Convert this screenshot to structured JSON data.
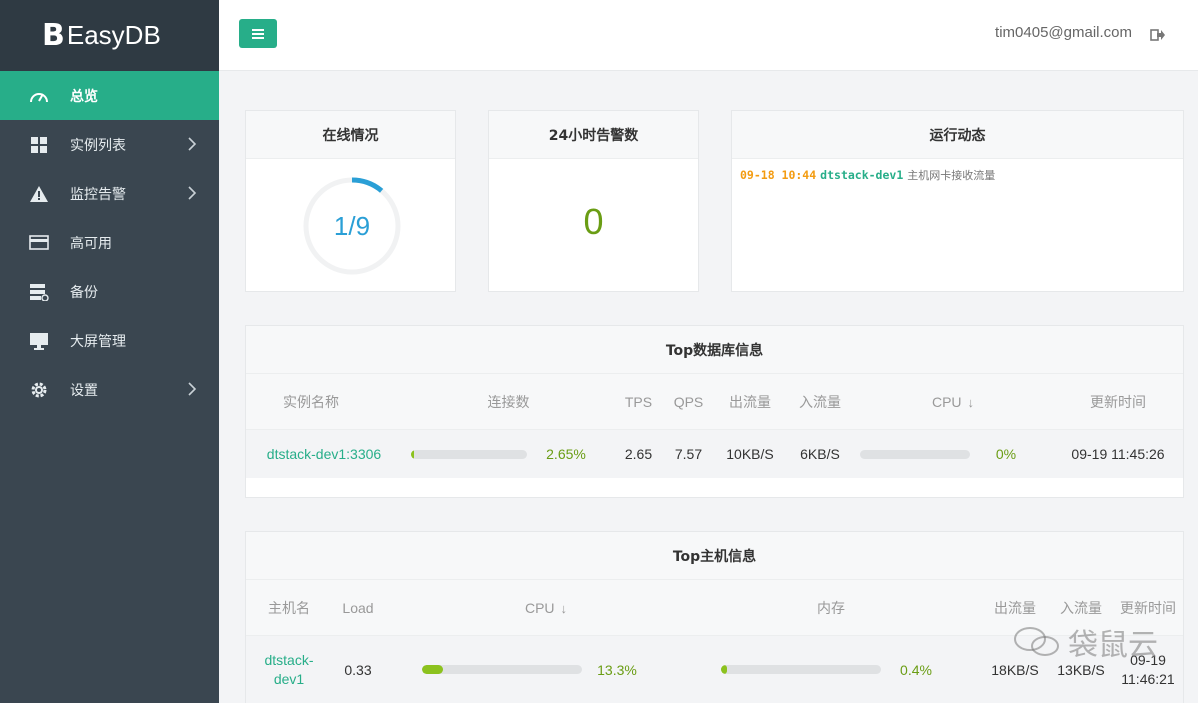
{
  "app": {
    "logo_mark": "B",
    "title": "EasyDB"
  },
  "sidebar": {
    "items": [
      {
        "label": "总览",
        "icon": "gauge-icon",
        "active": true
      },
      {
        "label": "实例列表",
        "icon": "grid-icon"
      },
      {
        "label": "监控告警",
        "icon": "warning-icon"
      },
      {
        "label": "高可用",
        "icon": "card-icon"
      },
      {
        "label": "备份",
        "icon": "server-backup-icon"
      },
      {
        "label": "大屏管理",
        "icon": "monitor-icon"
      },
      {
        "label": "设置",
        "icon": "gear-icon"
      }
    ]
  },
  "header": {
    "user_email": "tim0405@gmail.com"
  },
  "online": {
    "title": "在线情况",
    "value": "1/9",
    "fraction": 0.111
  },
  "alerts": {
    "title": "24小时告警数",
    "value": "0"
  },
  "activity": {
    "title": "运行动态",
    "events": [
      {
        "time": "09-18 10:44",
        "host": "dtstack-dev1",
        "message": "主机网卡接收流量"
      }
    ]
  },
  "top_db": {
    "title": "Top数据库信息",
    "columns": [
      "实例名称",
      "连接数",
      "TPS",
      "QPS",
      "出流量",
      "入流量",
      "CPU",
      "更新时间"
    ],
    "rows": [
      {
        "name": "dtstack-dev1:3306",
        "conn_pct": "2.65%",
        "conn_frac": 0.0265,
        "tps": "2.65",
        "qps": "7.57",
        "out": "10KB/S",
        "in": "6KB/S",
        "cpu_pct": "0%",
        "cpu_frac": 0,
        "updated": "09-19 11:45:26"
      }
    ]
  },
  "top_host": {
    "title": "Top主机信息",
    "columns": [
      "主机名",
      "Load",
      "CPU",
      "内存",
      "出流量",
      "入流量",
      "更新时间"
    ],
    "rows": [
      {
        "name_line1": "dtstack-",
        "name_line2": "dev1",
        "load": "0.33",
        "cpu_pct": "13.3%",
        "cpu_frac": 0.133,
        "mem_pct": "0.4%",
        "mem_frac": 0.04,
        "out": "18KB/S",
        "in": "13KB/S",
        "updated_line1": "09-19",
        "updated_line2": "11:46:21"
      }
    ]
  },
  "watermark": {
    "text": "袋鼠云"
  },
  "colors": {
    "accent": "#27ae89",
    "sidebar": "#3a4650",
    "ring": "#2a9fd6",
    "bar": "#8cc21e",
    "time": "#f39c12"
  }
}
